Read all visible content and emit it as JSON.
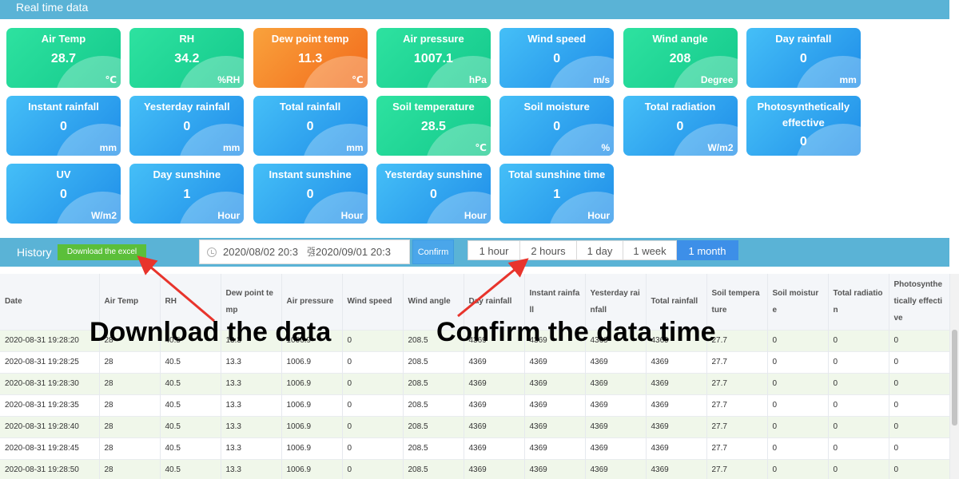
{
  "realtime": {
    "title": "Real time data",
    "cards": [
      {
        "name": "Air Temp",
        "value": "28.7",
        "unit": "℃",
        "color": "green"
      },
      {
        "name": "RH",
        "value": "34.2",
        "unit": "%RH",
        "color": "green"
      },
      {
        "name": "Dew point temp",
        "value": "11.3",
        "unit": "℃",
        "color": "orange"
      },
      {
        "name": "Air pressure",
        "value": "1007.1",
        "unit": "hPa",
        "color": "green"
      },
      {
        "name": "Wind speed",
        "value": "0",
        "unit": "m/s",
        "color": "blue"
      },
      {
        "name": "Wind angle",
        "value": "208",
        "unit": "Degree",
        "color": "green"
      },
      {
        "name": "Day rainfall",
        "value": "0",
        "unit": "mm",
        "color": "blue"
      },
      {
        "name": "Instant rainfall",
        "value": "0",
        "unit": "mm",
        "color": "blue"
      },
      {
        "name": "Yesterday rainfall",
        "value": "0",
        "unit": "mm",
        "color": "blue"
      },
      {
        "name": "Total rainfall",
        "value": "0",
        "unit": "mm",
        "color": "blue"
      },
      {
        "name": "Soil temperature",
        "value": "28.5",
        "unit": "℃",
        "color": "green"
      },
      {
        "name": "Soil moisture",
        "value": "0",
        "unit": "%",
        "color": "blue"
      },
      {
        "name": "Total radiation",
        "value": "0",
        "unit": "W/m2",
        "color": "blue"
      },
      {
        "name": "Photosynthetically effective",
        "value": "0",
        "unit": "",
        "color": "blue"
      },
      {
        "name": "UV",
        "value": "0",
        "unit": "W/m2",
        "color": "blue"
      },
      {
        "name": "Day sunshine",
        "value": "1",
        "unit": "Hour",
        "color": "blue"
      },
      {
        "name": "Instant sunshine",
        "value": "0",
        "unit": "Hour",
        "color": "blue"
      },
      {
        "name": "Yesterday sunshine",
        "value": "0",
        "unit": "Hour",
        "color": "blue"
      },
      {
        "name": "Total sunshine time",
        "value": "1",
        "unit": "Hour",
        "color": "blue"
      }
    ]
  },
  "history": {
    "title": "History",
    "download_label": "Download the excel",
    "date_start": "2020/08/02 20:3",
    "date_sep": "强",
    "date_end": "2020/09/01 20:3",
    "confirm_label": "Confirm",
    "ranges": [
      "1 hour",
      "2 hours",
      "1 day",
      "1 week",
      "1 month"
    ],
    "active_range": "1 month"
  },
  "table": {
    "columns": [
      "Date",
      "Air Temp",
      "RH",
      "Dew point temp",
      "Air pressure",
      "Wind speed",
      "Wind angle",
      "Day rainfall",
      "Instant rainfall",
      "Yesterday rainfall",
      "Total rainfall",
      "Soil temperature",
      "Soil moisture",
      "Total radiation",
      "Photosynthetically effective"
    ],
    "rows": [
      [
        "2020-08-31 19:28:20",
        "28",
        "40.5",
        "13.3",
        "1006.9",
        "0",
        "208.5",
        "4369",
        "4369",
        "4369",
        "4369",
        "27.7",
        "0",
        "0",
        "0"
      ],
      [
        "2020-08-31 19:28:25",
        "28",
        "40.5",
        "13.3",
        "1006.9",
        "0",
        "208.5",
        "4369",
        "4369",
        "4369",
        "4369",
        "27.7",
        "0",
        "0",
        "0"
      ],
      [
        "2020-08-31 19:28:30",
        "28",
        "40.5",
        "13.3",
        "1006.9",
        "0",
        "208.5",
        "4369",
        "4369",
        "4369",
        "4369",
        "27.7",
        "0",
        "0",
        "0"
      ],
      [
        "2020-08-31 19:28:35",
        "28",
        "40.5",
        "13.3",
        "1006.9",
        "0",
        "208.5",
        "4369",
        "4369",
        "4369",
        "4369",
        "27.7",
        "0",
        "0",
        "0"
      ],
      [
        "2020-08-31 19:28:40",
        "28",
        "40.5",
        "13.3",
        "1006.9",
        "0",
        "208.5",
        "4369",
        "4369",
        "4369",
        "4369",
        "27.7",
        "0",
        "0",
        "0"
      ],
      [
        "2020-08-31 19:28:45",
        "28",
        "40.5",
        "13.3",
        "1006.9",
        "0",
        "208.5",
        "4369",
        "4369",
        "4369",
        "4369",
        "27.7",
        "0",
        "0",
        "0"
      ],
      [
        "2020-08-31 19:28:50",
        "28",
        "40.5",
        "13.3",
        "1006.9",
        "0",
        "208.5",
        "4369",
        "4369",
        "4369",
        "4369",
        "27.7",
        "0",
        "0",
        "0"
      ]
    ]
  },
  "annotations": {
    "download": "Download the data",
    "confirm": "Confirm the data time",
    "arrow_color": "#e8342c"
  },
  "colors": {
    "header_bar": "#5ab3d6",
    "card_green": "#14c98c",
    "card_blue": "#1f8de8",
    "card_orange": "#f26a1b",
    "download_button": "#5bbf3a",
    "active_range": "#3d8fe8"
  }
}
